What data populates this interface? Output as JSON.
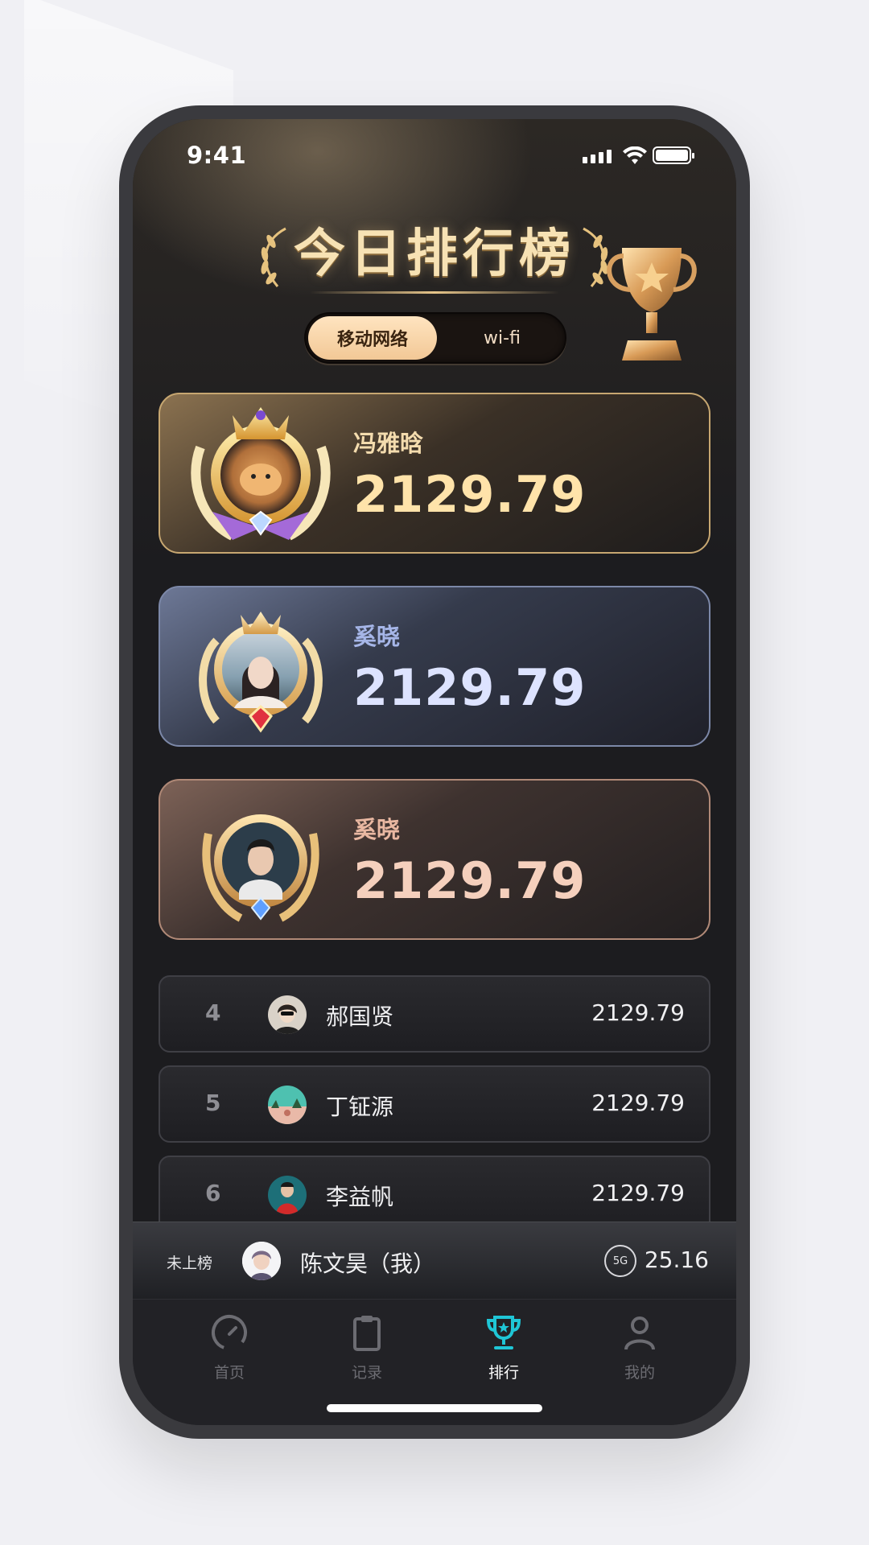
{
  "status_bar": {
    "time": "9:41"
  },
  "header": {
    "title": "今日排行榜",
    "toggle": {
      "active": "移动网络",
      "inactive": "wi-fi"
    }
  },
  "top3": [
    {
      "rank": 1,
      "name": "冯雅晗",
      "score": "2129.79"
    },
    {
      "rank": 2,
      "name": "奚晓",
      "score": "2129.79"
    },
    {
      "rank": 3,
      "name": "奚晓",
      "score": "2129.79"
    }
  ],
  "list": [
    {
      "rank": "4",
      "name": "郝国贤",
      "score": "2129.79"
    },
    {
      "rank": "5",
      "name": "丁钲源",
      "score": "2129.79"
    },
    {
      "rank": "6",
      "name": "李益帆",
      "score": "2129.79"
    }
  ],
  "my_rank": {
    "label": "未上榜",
    "name": "陈文昊（我）",
    "network": "5G",
    "score": "25.16"
  },
  "tabs": [
    {
      "label": "首页",
      "icon": "gauge-icon"
    },
    {
      "label": "记录",
      "icon": "clipboard-icon"
    },
    {
      "label": "排行",
      "icon": "trophy-icon"
    },
    {
      "label": "我的",
      "icon": "person-icon"
    }
  ],
  "colors": {
    "accent_tab": "#1fc6d6",
    "gold": "#ffe3aa",
    "silver": "#dde3ff",
    "bronze": "#f5d0bd"
  }
}
